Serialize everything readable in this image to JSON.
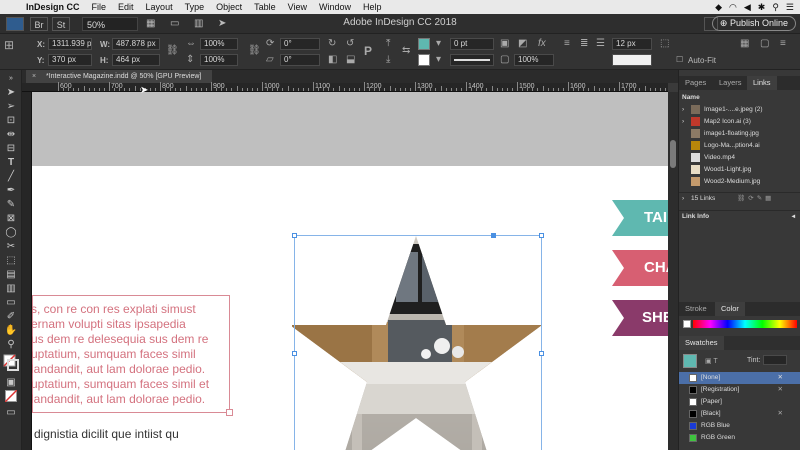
{
  "menubar": {
    "app": "InDesign CC",
    "items": [
      "File",
      "Edit",
      "Layout",
      "Type",
      "Object",
      "Table",
      "View",
      "Window",
      "Help"
    ]
  },
  "appbar": {
    "badge_br": "Br",
    "badge_st": "St",
    "zoom": "50%",
    "title": "Adobe InDesign CC 2018",
    "publish": "Publish Online"
  },
  "controlbar": {
    "x_label": "X:",
    "x_value": "1311.939 px",
    "y_label": "Y:",
    "y_value": "370 px",
    "w_label": "W:",
    "w_value": "487.878 px",
    "h_label": "H:",
    "h_value": "464 px",
    "scale_x": "100%",
    "scale_y": "100%",
    "rotate": "0°",
    "shear": "0°",
    "stroke_weight": "0 pt",
    "opacity": "100%",
    "size": "12 px",
    "auto_fit": "Auto-Fit"
  },
  "document": {
    "tab": "*Interactive Magazine.indd @ 50% [GPU Preview]",
    "ruler_labels": [
      "600",
      "700",
      "800",
      "900",
      "1000",
      "1100",
      "1200",
      "1300",
      "1400",
      "1500",
      "1600",
      "1700"
    ],
    "body_lines": [
      "s, con re con res explati simust",
      "ernam volupti sitas ipsapedia",
      "us dem re delesequia sus dem re",
      "uptatium, sumquam faces simil",
      "landandit, aut lam dolorae pedio.",
      "uptatium, sumquam faces simil et",
      "landandit, aut lam dolorae pedio."
    ],
    "bottom_line": "dignistia dicilit que intiist qu",
    "ribbons": [
      {
        "label": "TAI",
        "color": "#5fb8b0"
      },
      {
        "label": "CHA",
        "color": "#d75f72"
      },
      {
        "label": "SHE",
        "color": "#8a3a6a"
      }
    ]
  },
  "panels": {
    "tabs": [
      "Pages",
      "Layers",
      "Links"
    ],
    "links_header": "Name",
    "links": [
      {
        "name": "Image1-....e.jpeg (2)",
        "color": "#7a6b5a"
      },
      {
        "name": "Map2 Icon.ai (3)",
        "color": "#c0392b"
      },
      {
        "name": "image1-floating.jpg",
        "color": "#8c7a65"
      },
      {
        "name": "Logo-Ma...ption4.ai",
        "color": "#b8860b"
      },
      {
        "name": "Video.mp4",
        "color": "#dddddd"
      },
      {
        "name": "Wood1-Light.jpg",
        "color": "#e8dcc4"
      },
      {
        "name": "Wood2-Medium.jpg",
        "color": "#c49a6c"
      }
    ],
    "links_count": "15 Links",
    "link_info": "Link Info",
    "stroke_tab": "Stroke",
    "color_tab": "Color",
    "swatches_title": "Swatches",
    "tint_label": "Tint:",
    "swatches": [
      {
        "name": "[None]",
        "color": "none",
        "selected": true
      },
      {
        "name": "[Registration]",
        "color": "#000000",
        "selected": false
      },
      {
        "name": "[Paper]",
        "color": "#ffffff",
        "selected": false
      },
      {
        "name": "[Black]",
        "color": "#000000",
        "selected": false
      },
      {
        "name": "RGB Blue",
        "color": "#1a3bd8",
        "selected": false
      },
      {
        "name": "RGB Green",
        "color": "#3fc43f",
        "selected": false
      }
    ]
  }
}
